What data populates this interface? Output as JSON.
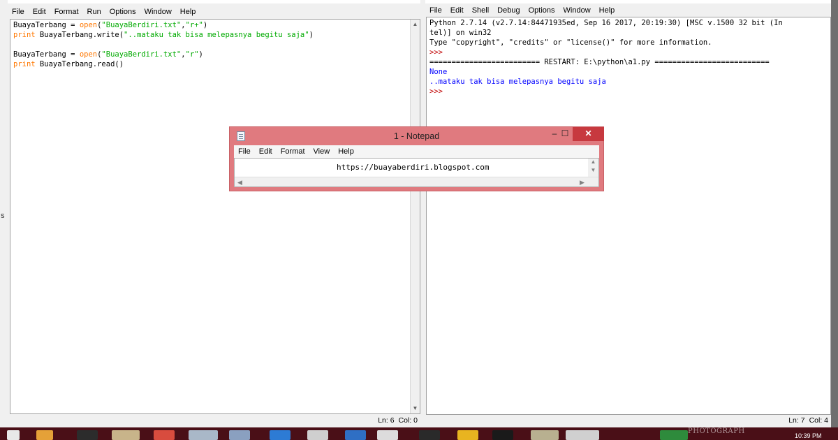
{
  "editor": {
    "menu": [
      "File",
      "Edit",
      "Format",
      "Run",
      "Options",
      "Window",
      "Help"
    ],
    "lines": [
      [
        {
          "t": "BuayaTerbang = ",
          "c": ""
        },
        {
          "t": "open",
          "c": "kw"
        },
        {
          "t": "(",
          "c": ""
        },
        {
          "t": "\"BuayaBerdiri.txt\"",
          "c": "str"
        },
        {
          "t": ",",
          "c": ""
        },
        {
          "t": "\"r+\"",
          "c": "str"
        },
        {
          "t": ")",
          "c": ""
        }
      ],
      [
        {
          "t": "print",
          "c": "kw"
        },
        {
          "t": " BuayaTerbang.write(",
          "c": ""
        },
        {
          "t": "\"..mataku tak bisa melepasnya begitu saja\"",
          "c": "str"
        },
        {
          "t": ")",
          "c": ""
        }
      ],
      [],
      [
        {
          "t": "BuayaTerbang = ",
          "c": ""
        },
        {
          "t": "open",
          "c": "kw"
        },
        {
          "t": "(",
          "c": ""
        },
        {
          "t": "\"BuayaBerdiri.txt\"",
          "c": "str"
        },
        {
          "t": ",",
          "c": ""
        },
        {
          "t": "\"r\"",
          "c": "str"
        },
        {
          "t": ")",
          "c": ""
        }
      ],
      [
        {
          "t": "print",
          "c": "kw"
        },
        {
          "t": " BuayaTerbang.read()",
          "c": ""
        }
      ]
    ],
    "status_ln": "Ln: 6",
    "status_col": "Col: 0"
  },
  "shell": {
    "menu": [
      "File",
      "Edit",
      "Shell",
      "Debug",
      "Options",
      "Window",
      "Help"
    ],
    "lines": [
      [
        {
          "t": "Python 2.7.14 (v2.7.14:84471935ed, Sep 16 2017, 20:19:30) [MSC v.1500 32 bit (In",
          "c": ""
        }
      ],
      [
        {
          "t": "tel)] on win32",
          "c": ""
        }
      ],
      [
        {
          "t": "Type \"copyright\", \"credits\" or \"license()\" for more information.",
          "c": ""
        }
      ],
      [
        {
          "t": ">>> ",
          "c": "red"
        }
      ],
      [
        {
          "t": "========================= RESTART: E:\\python\\a1.py ==========================",
          "c": ""
        }
      ],
      [
        {
          "t": "None",
          "c": "blue"
        }
      ],
      [
        {
          "t": "..mataku tak bisa melepasnya begitu saja",
          "c": "blue"
        }
      ],
      [
        {
          "t": ">>> ",
          "c": "red"
        }
      ]
    ],
    "status_ln": "Ln: 7",
    "status_col": "Col: 4"
  },
  "notepad": {
    "title": "1 - Notepad",
    "menu": [
      "File",
      "Edit",
      "Format",
      "View",
      "Help"
    ],
    "content": "https://buayaberdiri.blogspot.com",
    "close_glyph": "✕",
    "minimize_glyph": "–",
    "maximize_glyph": "☐"
  },
  "desktop": {
    "left_char": "s",
    "clock": "10:39 PM",
    "watermark": "PHOTOGRAPH"
  },
  "colors": {
    "notepad_title_bg": "#e07a7f",
    "close_button": "#c7393f",
    "keyword": "#ff7700",
    "string": "#00aa00",
    "output": "#0000ff",
    "prompt": "#c00000",
    "taskbar": "#4a0f17"
  }
}
